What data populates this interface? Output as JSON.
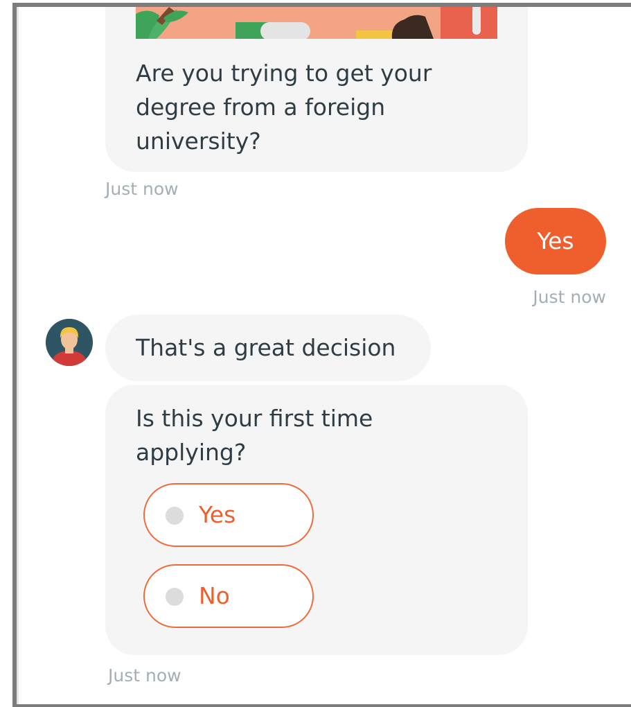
{
  "messages": [
    {
      "sender": "bot",
      "text": "Are you trying to get your degree from a foreign university?",
      "timestamp": "Just now"
    },
    {
      "sender": "user",
      "text": "Yes",
      "timestamp": "Just now"
    },
    {
      "sender": "bot",
      "text": "That's a great decision"
    },
    {
      "sender": "bot",
      "text": "Is this your first time applying?",
      "options": [
        "Yes",
        "No"
      ],
      "timestamp": "Just now"
    }
  ],
  "colors": {
    "accent": "#ef5f2d",
    "bot_bubble": "#f5f5f5",
    "text": "#2e3d45",
    "timestamp": "#a3afb5"
  },
  "icons": {
    "avatar": "bot-avatar-icon",
    "option_radio": "radio-icon"
  }
}
